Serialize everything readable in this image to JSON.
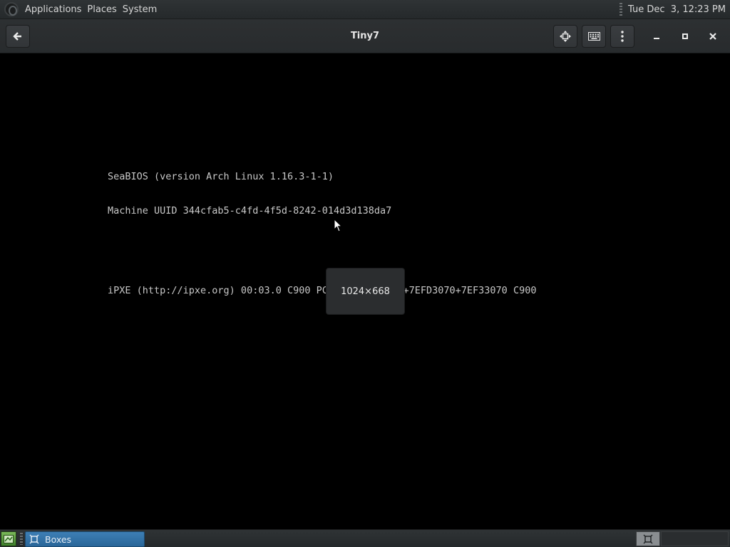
{
  "top_panel": {
    "menus": [
      "Applications",
      "Places",
      "System"
    ],
    "clock": "Tue Dec  3, 12:23 PM"
  },
  "window": {
    "title": "Tiny7"
  },
  "vm_screen": {
    "bios_line_1": "SeaBIOS (version Arch Linux 1.16.3-1-1)",
    "bios_line_2": "Machine UUID 344cfab5-c4fd-4f5d-8242-014d3d138da7",
    "ipxe_line": "iPXE (http://ipxe.org) 00:03.0 C900 PCI2.10 PnP PMM+7EFD3070+7EF33070 C900",
    "resolution_popup": "1024×668"
  },
  "bottom_panel": {
    "task_label": "Boxes"
  },
  "icons": {
    "back": "back-arrow-icon",
    "fullscreen": "fullscreen-move-icon",
    "keyboard": "keyboard-icon",
    "menu": "kebab-menu-icon",
    "minimize": "minimize-icon",
    "maximize": "maximize-icon",
    "close": "close-icon",
    "boxes": "boxes-app-icon"
  },
  "colors": {
    "panel_bg": "#2b2f31",
    "task_active": "#3474a8",
    "bios_text": "#c8c8c8"
  }
}
